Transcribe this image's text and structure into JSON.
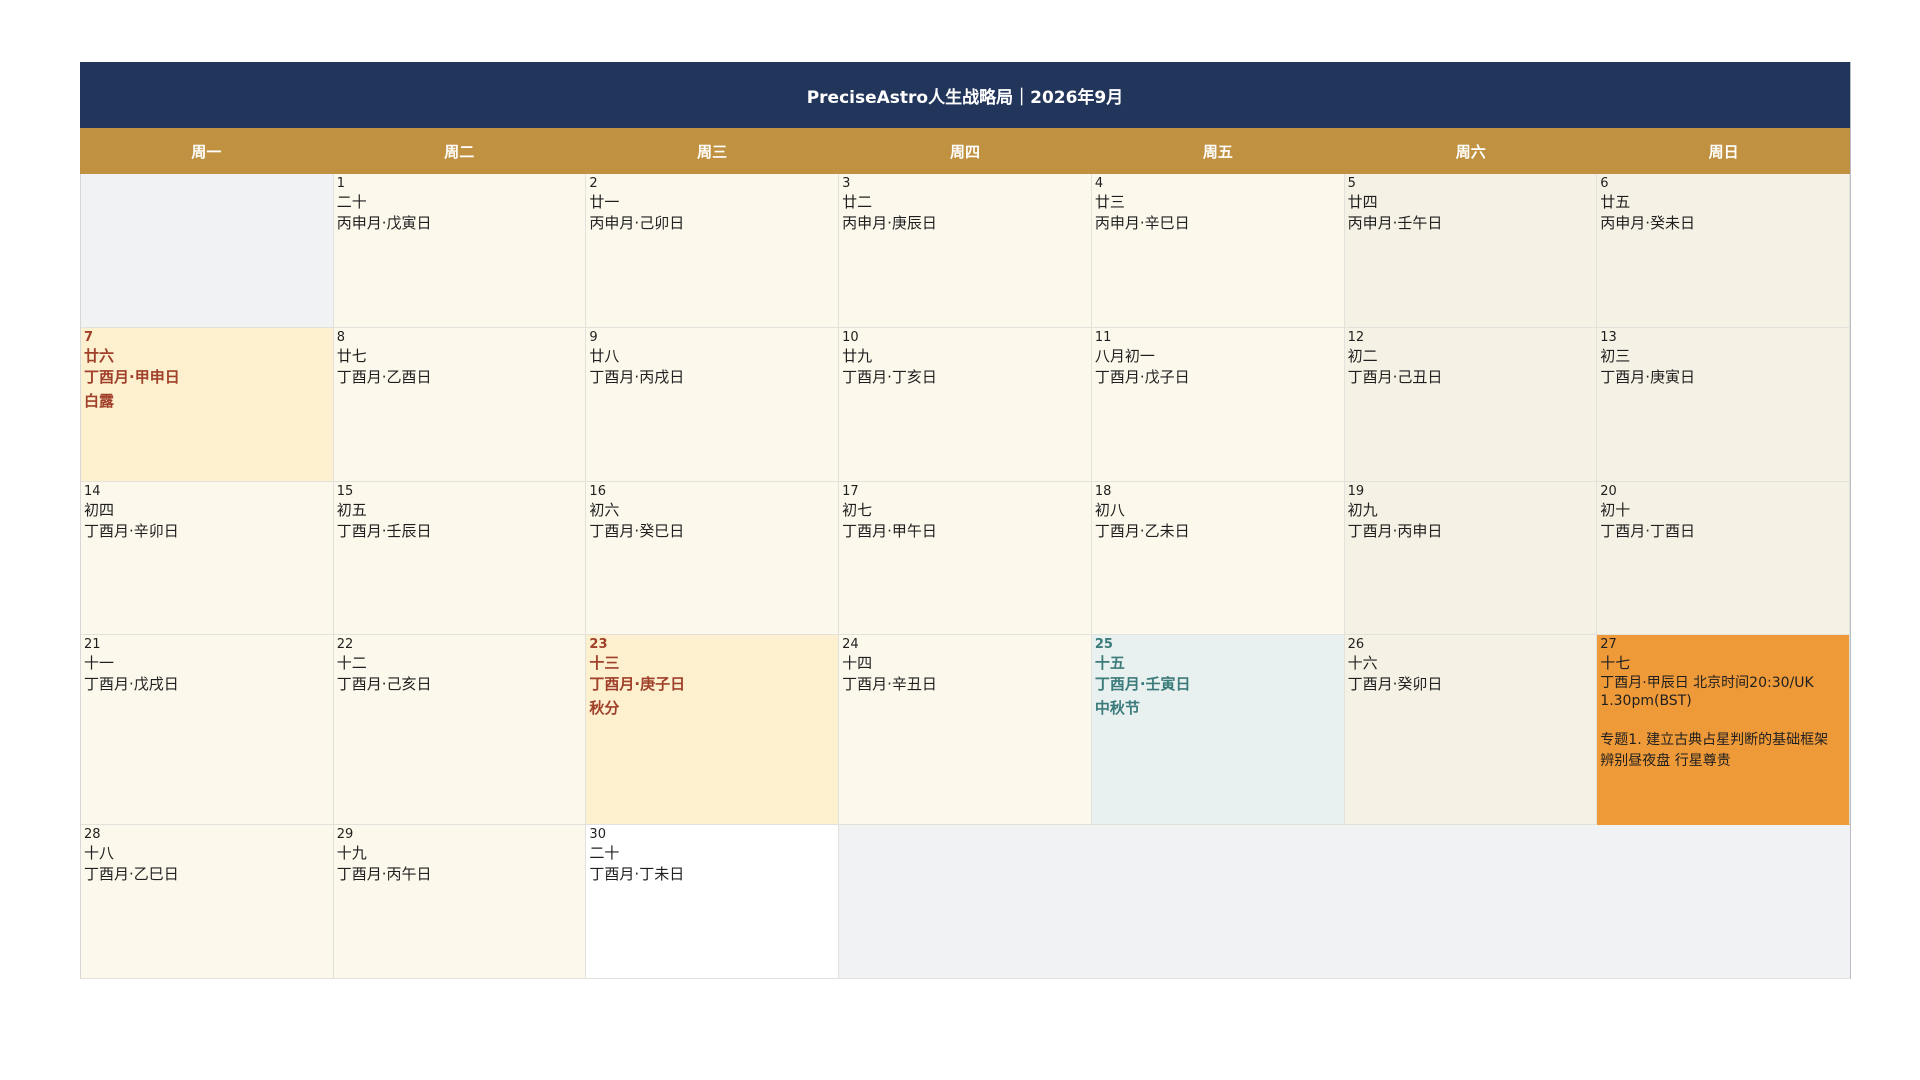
{
  "title": "PreciseAstro人生战略局｜2026年9月",
  "weekdays": [
    "周一",
    "周二",
    "周三",
    "周四",
    "周五",
    "周六",
    "周日"
  ],
  "days": {
    "d1": {
      "day": "1",
      "lunar": "二十",
      "ganzhi": "丙申月·戊寅日"
    },
    "d2": {
      "day": "2",
      "lunar": "廿一",
      "ganzhi": "丙申月·己卯日"
    },
    "d3": {
      "day": "3",
      "lunar": "廿二",
      "ganzhi": "丙申月·庚辰日"
    },
    "d4": {
      "day": "4",
      "lunar": "廿三",
      "ganzhi": "丙申月·辛巳日"
    },
    "d5": {
      "day": "5",
      "lunar": "廿四",
      "ganzhi": "丙申月·壬午日"
    },
    "d6": {
      "day": "6",
      "lunar": "廿五",
      "ganzhi": "丙申月·癸未日"
    },
    "d7": {
      "day": "7",
      "lunar": "廿六",
      "ganzhi": "丁酉月·甲申日",
      "festival": "白露"
    },
    "d8": {
      "day": "8",
      "lunar": "廿七",
      "ganzhi": "丁酉月·乙酉日"
    },
    "d9": {
      "day": "9",
      "lunar": "廿八",
      "ganzhi": "丁酉月·丙戌日"
    },
    "d10": {
      "day": "10",
      "lunar": "廿九",
      "ganzhi": "丁酉月·丁亥日"
    },
    "d11": {
      "day": "11",
      "lunar": "八月初一",
      "ganzhi": "丁酉月·戊子日"
    },
    "d12": {
      "day": "12",
      "lunar": "初二",
      "ganzhi": "丁酉月·己丑日"
    },
    "d13": {
      "day": "13",
      "lunar": "初三",
      "ganzhi": "丁酉月·庚寅日"
    },
    "d14": {
      "day": "14",
      "lunar": "初四",
      "ganzhi": "丁酉月·辛卯日"
    },
    "d15": {
      "day": "15",
      "lunar": "初五",
      "ganzhi": "丁酉月·壬辰日"
    },
    "d16": {
      "day": "16",
      "lunar": "初六",
      "ganzhi": "丁酉月·癸巳日"
    },
    "d17": {
      "day": "17",
      "lunar": "初七",
      "ganzhi": "丁酉月·甲午日"
    },
    "d18": {
      "day": "18",
      "lunar": "初八",
      "ganzhi": "丁酉月·乙未日"
    },
    "d19": {
      "day": "19",
      "lunar": "初九",
      "ganzhi": "丁酉月·丙申日"
    },
    "d20": {
      "day": "20",
      "lunar": "初十",
      "ganzhi": "丁酉月·丁酉日"
    },
    "d21": {
      "day": "21",
      "lunar": "十一",
      "ganzhi": "丁酉月·戊戌日"
    },
    "d22": {
      "day": "22",
      "lunar": "十二",
      "ganzhi": "丁酉月·己亥日"
    },
    "d23": {
      "day": "23",
      "lunar": "十三",
      "ganzhi": "丁酉月·庚子日",
      "festival": "秋分"
    },
    "d24": {
      "day": "24",
      "lunar": "十四",
      "ganzhi": "丁酉月·辛丑日"
    },
    "d25": {
      "day": "25",
      "lunar": "十五",
      "ganzhi": "丁酉月·壬寅日",
      "festival": "中秋节"
    },
    "d26": {
      "day": "26",
      "lunar": "十六",
      "ganzhi": "丁酉月·癸卯日"
    },
    "d27": {
      "day": "27",
      "lunar": "十七",
      "event_line1": "丁酉月·甲辰日  北京时间20:30/UK",
      "event_line2": "1.30pm(BST)",
      "event_topic1": "专题1.  建立古典占星判断的基础框架",
      "event_topic2": "辨别昼夜盘 行星尊贵"
    },
    "d28": {
      "day": "28",
      "lunar": "十八",
      "ganzhi": "丁酉月·乙巳日"
    },
    "d29": {
      "day": "29",
      "lunar": "十九",
      "ganzhi": "丁酉月·丙午日"
    },
    "d30": {
      "day": "30",
      "lunar": "二十",
      "ganzhi": "丁酉月·丁未日"
    }
  },
  "colors": {
    "title_bar": "#22355a",
    "weekday_bar": "#c09140",
    "weekday_cell": "#fcf8ec",
    "weekend_cell": "#f6f1e5",
    "solar_term_cell": "#fcf0cf",
    "festival_cell": "#e8f1ef",
    "event_cell": "#ef9a38"
  }
}
